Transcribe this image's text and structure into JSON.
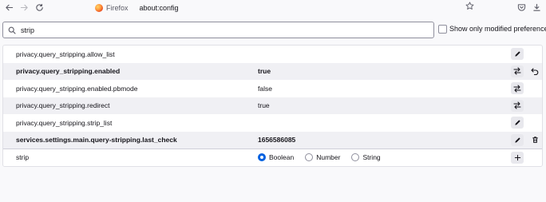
{
  "browser": {
    "identity_label": "Firefox",
    "url": "about:config"
  },
  "search": {
    "value": "strip",
    "show_modified_label": "Show only modified preferences",
    "show_modified_checked": false
  },
  "prefs": [
    {
      "name": "privacy.query_stripping.allow_list",
      "value": "",
      "modified": false,
      "action": "edit"
    },
    {
      "name": "privacy.query_stripping.enabled",
      "value": "true",
      "modified": true,
      "action": "toggle",
      "reset": true
    },
    {
      "name": "privacy.query_stripping.enabled.pbmode",
      "value": "false",
      "modified": false,
      "action": "toggle"
    },
    {
      "name": "privacy.query_stripping.redirect",
      "value": "true",
      "modified": false,
      "action": "toggle"
    },
    {
      "name": "privacy.query_stripping.strip_list",
      "value": "",
      "modified": false,
      "action": "edit"
    },
    {
      "name": "services.settings.main.query-stripping.last_check",
      "value": "1656586085",
      "modified": true,
      "action": "edit",
      "delete": true
    }
  ],
  "new_pref": {
    "name": "strip",
    "types": [
      "Boolean",
      "Number",
      "String"
    ],
    "selected_type": "Boolean"
  },
  "icons": {
    "back": "arrow-left-icon",
    "forward": "arrow-right-icon",
    "reload": "reload-icon",
    "bookmark": "star-icon",
    "pocket": "pocket-icon",
    "downloads": "download-icon",
    "edit": "pencil-icon",
    "toggle": "swap-arrows-icon",
    "reset": "undo-arrow-icon",
    "delete": "trash-icon",
    "add": "plus-icon"
  },
  "colors": {
    "accent": "#0061e0",
    "alt_row": "#f0f0f4"
  }
}
